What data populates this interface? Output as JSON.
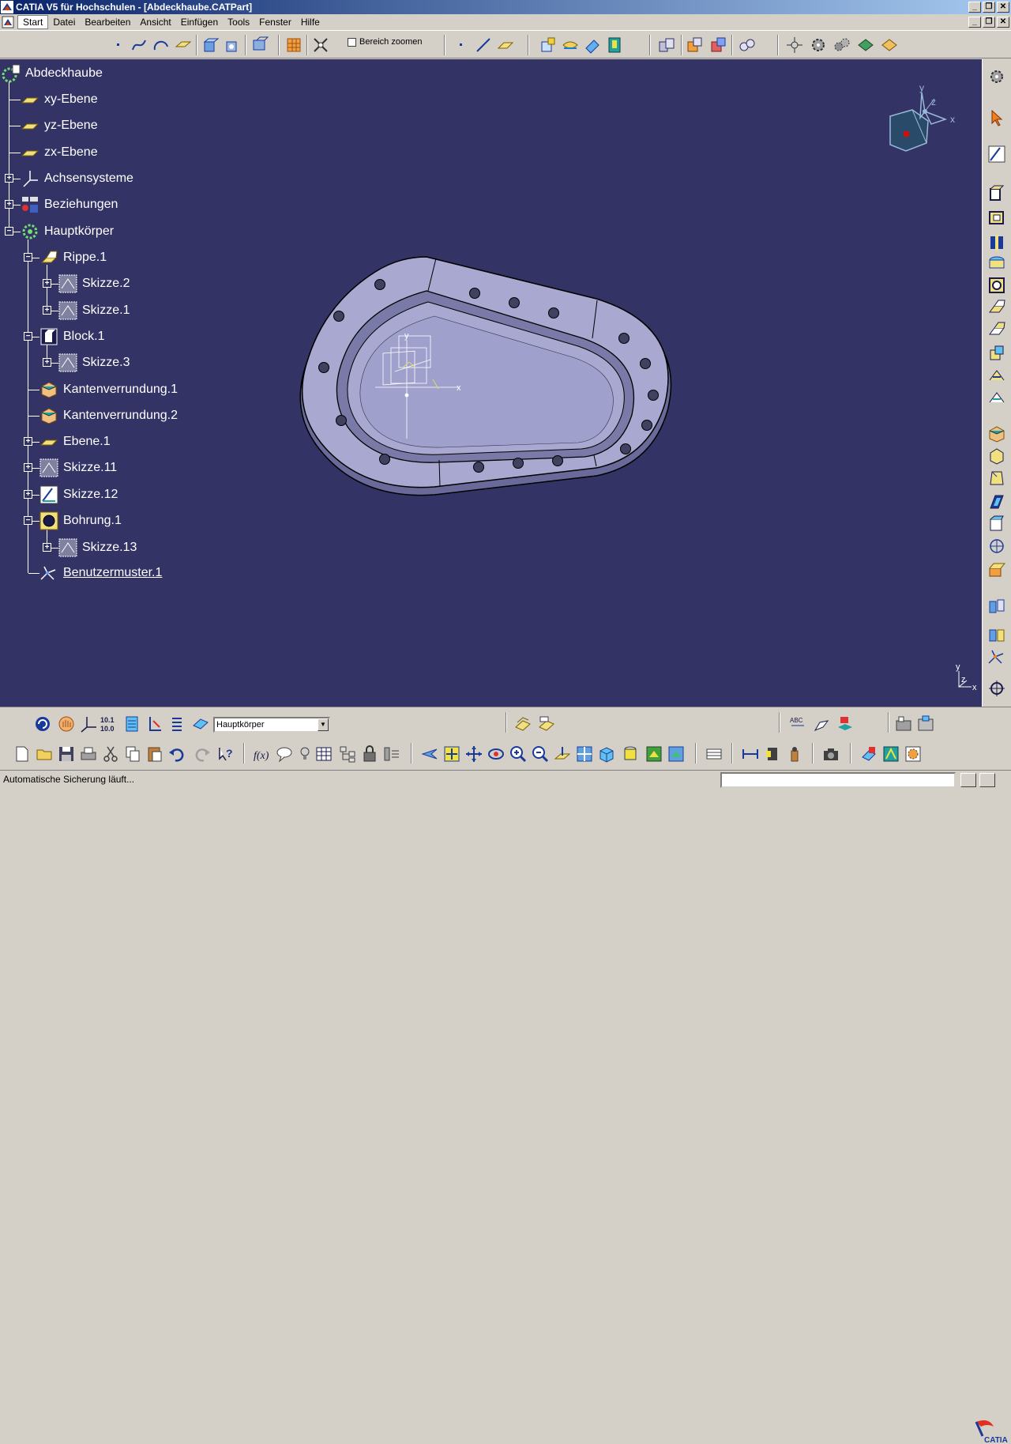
{
  "window": {
    "title": "CATIA V5 für Hochschulen - [Abdeckhaube.CATPart]"
  },
  "menubar": {
    "items": [
      {
        "label": "Start"
      },
      {
        "label": "Datei"
      },
      {
        "label": "Bearbeiten"
      },
      {
        "label": "Ansicht"
      },
      {
        "label": "Einfügen"
      },
      {
        "label": "Tools"
      },
      {
        "label": "Fenster"
      },
      {
        "label": "Hilfe"
      }
    ]
  },
  "toolbar_top": {
    "zoom_checkbox_label": "Bereich zoomen"
  },
  "tree": {
    "root": "Abdeckhaube",
    "items": [
      {
        "label": "xy-Ebene"
      },
      {
        "label": "yz-Ebene"
      },
      {
        "label": "zx-Ebene"
      },
      {
        "label": "Achsensysteme"
      },
      {
        "label": "Beziehungen"
      },
      {
        "label": "Hauptkörper"
      },
      {
        "label": "Rippe.1"
      },
      {
        "label": "Skizze.2"
      },
      {
        "label": "Skizze.1"
      },
      {
        "label": "Block.1"
      },
      {
        "label": "Skizze.3"
      },
      {
        "label": "Kantenverrundung.1"
      },
      {
        "label": "Kantenverrundung.2"
      },
      {
        "label": "Ebene.1"
      },
      {
        "label": "Skizze.11"
      },
      {
        "label": "Skizze.12"
      },
      {
        "label": "Bohrung.1"
      },
      {
        "label": "Skizze.13"
      },
      {
        "label": "Benutzermuster.1"
      }
    ]
  },
  "compass": {
    "x_label": "x",
    "y_label": "y",
    "z_label": "z"
  },
  "viewport": {
    "sketch_axis_x": "x",
    "sketch_axis_y": "y",
    "small_axis_x": "x",
    "small_axis_y": "y",
    "small_axis_z": "z"
  },
  "toolbar_bottom": {
    "body_select_value": "Hauptkörper"
  },
  "statusbar": {
    "text": "Automatische Sicherung läuft..."
  },
  "colors": {
    "viewport_bg": "#333366",
    "part_fill": "#a8a8d0",
    "ui_face": "#d4d0c8"
  }
}
